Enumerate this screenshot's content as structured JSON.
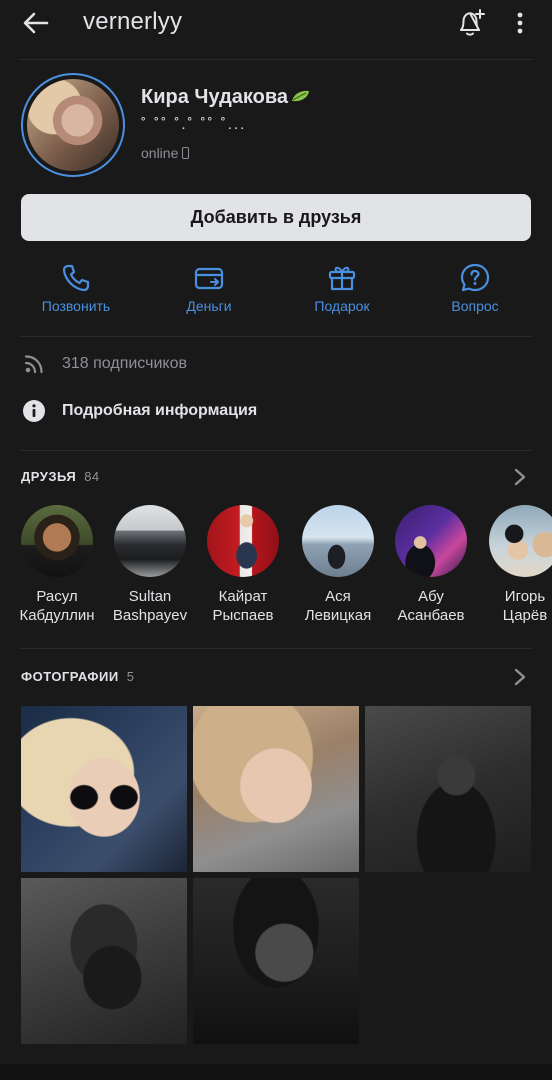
{
  "header": {
    "title": "vernerlyy",
    "icons": [
      "arrow-left-icon",
      "bell-plus-icon",
      "more-vertical-icon"
    ]
  },
  "profile": {
    "name": "Кира Чудакова",
    "status": "˚ ˚˚ ˚.˚ ˚˚ ˚...",
    "online": "online",
    "add_friend_label": "Добавить в друзья"
  },
  "actions": [
    {
      "label": "Позвонить",
      "icon": "phone-icon"
    },
    {
      "label": "Деньги",
      "icon": "money-card-icon"
    },
    {
      "label": "Подарок",
      "icon": "gift-icon"
    },
    {
      "label": "Вопрос",
      "icon": "question-icon"
    }
  ],
  "info": {
    "subscribers": "318 подписчиков",
    "details": "Подробная информация"
  },
  "friends": {
    "title": "ДРУЗЬЯ",
    "count": "84",
    "items": [
      {
        "first": "Расул",
        "last": "Кабдуллин"
      },
      {
        "first": "Sultan",
        "last": "Bashpayev"
      },
      {
        "first": "Кайрат",
        "last": "Рыспаев"
      },
      {
        "first": "Ася",
        "last": "Левицкая"
      },
      {
        "first": "Абу",
        "last": "Асанбаев"
      },
      {
        "first": "Игорь",
        "last": "Царёв"
      }
    ]
  },
  "photos": {
    "title": "ФОТОГРАФИИ",
    "count": "5"
  },
  "colors": {
    "background": "#19191a",
    "accent": "#4a90e0",
    "text": "#e1e3e6",
    "secondary_text": "#8e9096"
  }
}
